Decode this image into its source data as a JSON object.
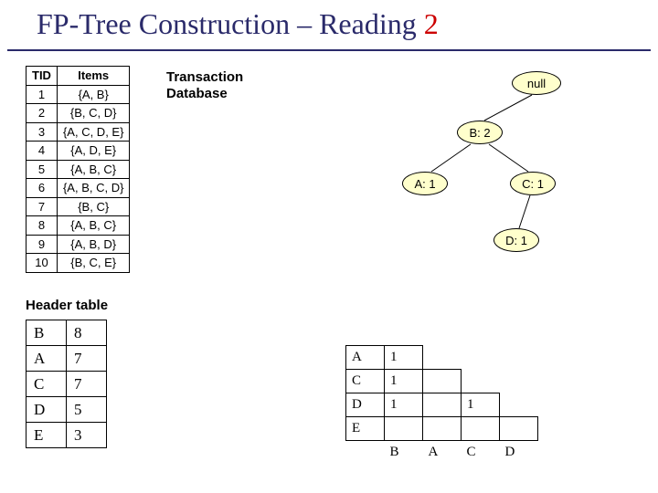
{
  "title_prefix": "FP-Tree Construction – Reading ",
  "title_num": "2",
  "txn_label_l1": "Transaction",
  "txn_label_l2": "Database",
  "txn_headers": {
    "tid": "TID",
    "items": "Items"
  },
  "txn_rows": [
    {
      "tid": "1",
      "items": "{A, B}"
    },
    {
      "tid": "2",
      "items": "{B, C, D}"
    },
    {
      "tid": "3",
      "items": "{A, C, D, E}"
    },
    {
      "tid": "4",
      "items": "{A, D, E}"
    },
    {
      "tid": "5",
      "items": "{A, B, C}"
    },
    {
      "tid": "6",
      "items": "{A, B, C, D}"
    },
    {
      "tid": "7",
      "items": "{B, C}"
    },
    {
      "tid": "8",
      "items": "{A, B, C}"
    },
    {
      "tid": "9",
      "items": "{A, B, D}"
    },
    {
      "tid": "10",
      "items": "{B, C, E}"
    }
  ],
  "header_table_label": "Header table",
  "header_table": [
    {
      "item": "B",
      "count": "8"
    },
    {
      "item": "A",
      "count": "7"
    },
    {
      "item": "C",
      "count": "7"
    },
    {
      "item": "D",
      "count": "5"
    },
    {
      "item": "E",
      "count": "3"
    }
  ],
  "tree": {
    "null": "null",
    "b2": "B: 2",
    "a1": "A: 1",
    "c1": "C: 1",
    "d1": "D: 1"
  },
  "matrix": {
    "row_items": [
      "A",
      "C",
      "D",
      "E"
    ],
    "col_items": [
      "B",
      "A",
      "C",
      "D"
    ],
    "cells": {
      "A": {
        "B": "1"
      },
      "C": {
        "B": "1"
      },
      "D": {
        "B": "1",
        "C": "1"
      },
      "E": {}
    }
  }
}
